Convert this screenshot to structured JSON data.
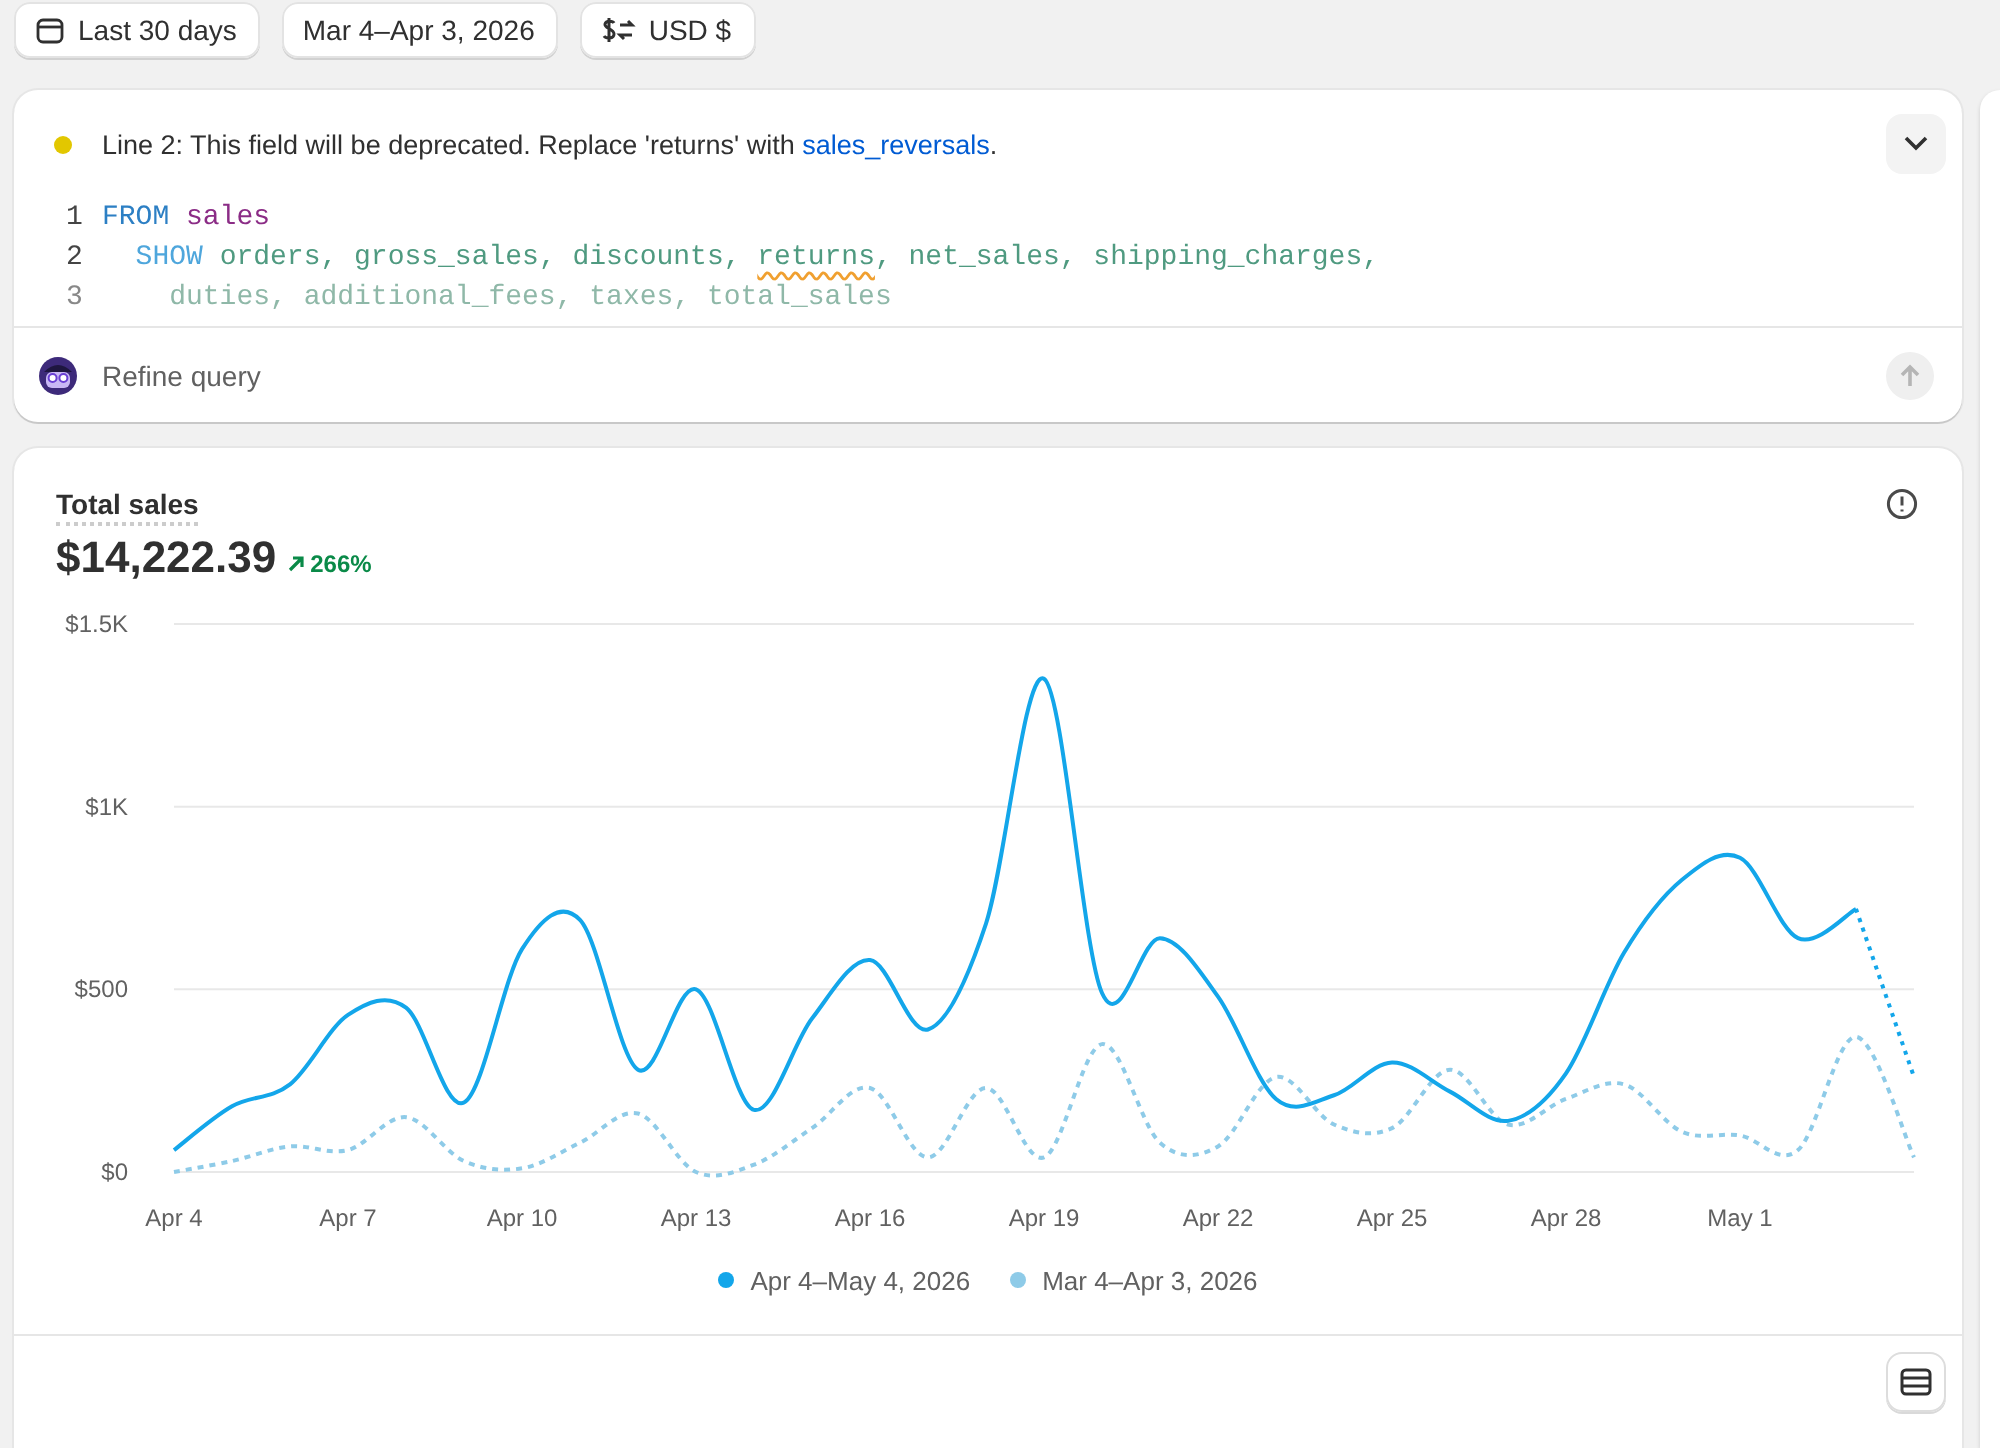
{
  "toolbar": [
    {
      "kind": "calendar",
      "label": "Last 30 days"
    },
    {
      "kind": "plain",
      "label": "Mar 4–Apr 3, 2026"
    },
    {
      "kind": "currency",
      "label": "USD $"
    }
  ],
  "query_editor": {
    "warning": {
      "text": "Line 2: This field will be deprecated. Replace 'returns' with ",
      "link": "sales_reversals",
      "after": "."
    },
    "expanded": false,
    "lines": [
      {
        "number": "1",
        "faded": false,
        "tokens": [
          {
            "kind": "keyword",
            "text": "FROM"
          },
          {
            "kind": "table",
            "text": "sales"
          }
        ]
      },
      {
        "number": "2",
        "faded": false,
        "tokens": [
          {
            "kind": "clause",
            "text": "  SHOW"
          },
          {
            "kind": "field",
            "text": "orders, gross_sales, discounts, "
          },
          {
            "kind": "field",
            "text": "returns",
            "warning": true
          },
          {
            "kind": "field",
            "text": ", net_sales, shipping_charges,"
          }
        ]
      },
      {
        "number": "3",
        "faded": true,
        "tokens": [
          {
            "kind": "field",
            "text": "    duties, additional_fees, taxes, total_sales"
          }
        ]
      }
    ],
    "prompt": {
      "placeholder": "Refine query"
    },
    "send_disabled": true
  },
  "metric": {
    "title": "Total sales",
    "value": "$14,222.39",
    "change": "266%",
    "chart_data": {
      "type": "line",
      "categories": [
        "Apr 4",
        null,
        null,
        "Apr 7",
        null,
        null,
        "Apr 10",
        null,
        null,
        "Apr 13",
        null,
        null,
        "Apr 16",
        null,
        null,
        "Apr 19",
        null,
        null,
        "Apr 22",
        null,
        null,
        "Apr 25",
        null,
        null,
        "Apr 28",
        null,
        null,
        "May 1",
        null,
        null,
        null
      ],
      "ylim": [
        0,
        1500
      ],
      "yticks": [
        {
          "value": 0,
          "label": "$0"
        },
        {
          "value": 500,
          "label": "$500"
        },
        {
          "value": 1000,
          "label": "$1K"
        },
        {
          "value": 1500,
          "label": "$1.5K"
        }
      ],
      "series": [
        {
          "name": "Apr 4–May 4, 2026",
          "color": "#13a6ea",
          "line_style": "solid",
          "values": [
            60,
            180,
            240,
            430,
            450,
            190,
            610,
            690,
            280,
            500,
            170,
            420,
            580,
            390,
            680,
            1350,
            490,
            640,
            480,
            200,
            210,
            300,
            220,
            140,
            270,
            600,
            800,
            860,
            640,
            720,
            260
          ]
        },
        {
          "name": "Mar 4–Apr 3, 2026",
          "color": "#8ecbe8",
          "line_style": "dashed",
          "values": [
            0,
            30,
            70,
            60,
            150,
            30,
            10,
            80,
            160,
            0,
            20,
            120,
            230,
            40,
            230,
            40,
            350,
            80,
            70,
            260,
            130,
            120,
            280,
            130,
            200,
            240,
            110,
            100,
            60,
            370,
            40
          ]
        }
      ]
    }
  }
}
